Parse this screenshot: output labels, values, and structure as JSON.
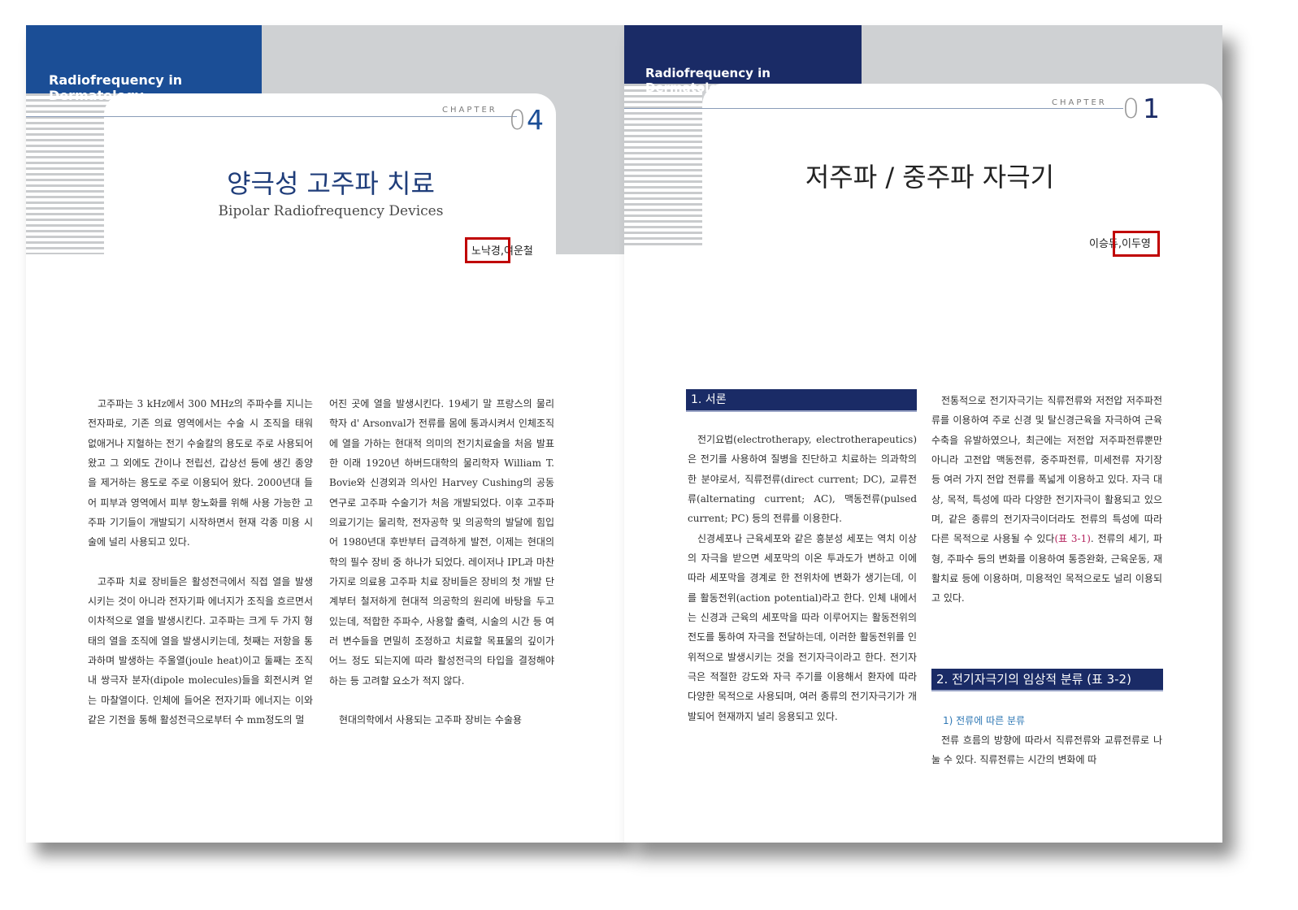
{
  "left_page": {
    "brand": "Radiofrequency in Dermatology",
    "chapter_word": "CHAPTER",
    "chapter_digit_a": "0",
    "chapter_digit_b": "4",
    "title": "양극성 고주파 치료",
    "subtitle": "Bipolar Radiofrequency Devices",
    "author_highlighted": "노낙경,",
    "author_other": "여운철",
    "col1_p1": "고주파는 3 kHz에서 300 MHz의 주파수를 지니는 전자파로, 기존 의료 영역에서는 수술 시 조직을 태워 없애거나 지혈하는 전기 수술칼의 용도로 주로 사용되어 왔고 그 외에도 간이나 전립선, 갑상선 등에 생긴 종양을 제거하는 용도로 주로 이용되어 왔다. 2000년대 들어 피부과 영역에서 피부 항노화를 위해 사용 가능한 고주파 기기들이 개발되기 시작하면서 현재 각종 미용 시술에 널리 사용되고 있다.",
    "col1_p2": "고주파 치료 장비들은 활성전극에서 직접 열을 발생시키는 것이 아니라 전자기파 에너지가 조직을 흐르면서 이차적으로 열을 발생시킨다. 고주파는 크게 두 가지 형태의 열을 조직에 열을 발생시키는데, 첫째는 저항을 통과하며 발생하는 주울열(joule heat)이고 둘째는 조직 내 쌍극자 분자(dipole molecules)들을 회전시켜 얻는 마찰열이다. 인체에 들어온 전자기파 에너지는 이와 같은 기전을 통해 활성전극으로부터 수 mm정도의 멀",
    "col2_p1": "어진 곳에 열을 발생시킨다. 19세기 말 프랑스의 물리학자 d' Arsonval가 전류를 몸에 통과시켜서 인체조직에 열을 가하는 현대적 의미의 전기치료술을 처음 발표한 이래 1920년 하버드대학의 물리학자 William T. Bovie와 신경외과 의사인 Harvey Cushing의 공동연구로 고주파 수술기가 처음 개발되었다. 이후 고주파 의료기기는 물리학, 전자공학 및 의공학의 발달에 힘입어 1980년대 후반부터 급격하게 발전, 이제는 현대의학의 필수 장비 중 하나가 되었다. 레이저나 IPL과 마찬가지로 의료용 고주파 치료 장비들은 장비의 첫 개발 단계부터 철저하게 현대적 의공학의 원리에 바탕을 두고 있는데, 적합한 주파수, 사용할 출력, 시술의 시간 등 여러 변수들을 면밀히 조정하고 치료할 목표물의 깊이가 어느 정도 되는지에 따라 활성전극의 타입을 결정해야 하는 등 고려할 요소가 적지 않다.",
    "col2_p2": "현대의학에서 사용되는 고주파 장비는 수술용"
  },
  "right_page": {
    "brand": "Radiofrequency in Dermatology",
    "chapter_word": "CHAPTER",
    "chapter_digit_a": "0",
    "chapter_digit_b": "1",
    "title": "저주파 / 중주파 자극기",
    "author_other": "이승듀,",
    "author_highlighted": "이두영",
    "section1_heading": "1. 서론",
    "col1_p1": "전기요법(electrotherapy, electrotherapeutics)은 전기를 사용하여 질병을 진단하고 치료하는 의과학의 한 분야로서, 직류전류(direct current; DC), 교류전류(alternating current; AC), 맥동전류(pulsed current; PC) 등의 전류를 이용한다.",
    "col1_p2": "신경세포나 근육세포와 같은 흥분성 세포는 역치 이상의 자극을 받으면 세포막의 이온 투과도가 변하고 이에 따라 세포막을 경계로 한 전위차에 변화가 생기는데, 이를 활동전위(action potential)라고 한다. 인체 내에서는 신경과 근육의 세포막을 따라 이루어지는 활동전위의 전도를 통하여 자극을 전달하는데, 이러한 활동전위를 인위적으로 발생시키는 것을 전기자극이라고 한다. 전기자극은 적절한 강도와 자극 주기를 이용해서 환자에 따라 다양한 목적으로 사용되며, 여러 종류의 전기자극기가 개발되어 현재까지 널리 응용되고 있다.",
    "col2_p1_before_ref": "전통적으로 전기자극기는 직류전류와 저전압 저주파전류를 이용하여 주로 신경 및 탈신경근육을 자극하여 근육수축을 유발하였으나, 최근에는 저전압 저주파전류뿐만 아니라 고전압 맥동전류, 중주파전류, 미세전류 자기장 등 여러 가지 전압 전류를 폭넓게 이용하고 있다. 자극 대상, 목적, 특성에 따라 다양한 전기자극이 활용되고 있으며, 같은 종류의 전기자극이더라도 전류의 특성에 따라 다른 목적으로 사용될 수 있다",
    "col2_p1_ref": "(표 3-1)",
    "col2_p1_after_ref": ". 전류의 세기, 파형, 주파수 등의 변화를 이용하여 통증완화, 근육운동, 재활치료 등에 이용하며, 미용적인 목적으로도 널리 이용되고 있다.",
    "section2_heading": "2. 전기자극기의 임상적 분류 (표 3-2)",
    "subsection_heading": "1) 전류에 따른 분류",
    "col2_p2": "전류 흐름의 방향에 따라서 직류전류와 교류전류로 나눌 수 있다. 직류전류는 시간의 변화에 따"
  },
  "colors": {
    "brand_left": "#1b4e96",
    "brand_right": "#1a2b66",
    "highlight_box": "#c00000",
    "title_text": "#1f3d7a",
    "grey_band": "#cfd1d3"
  }
}
